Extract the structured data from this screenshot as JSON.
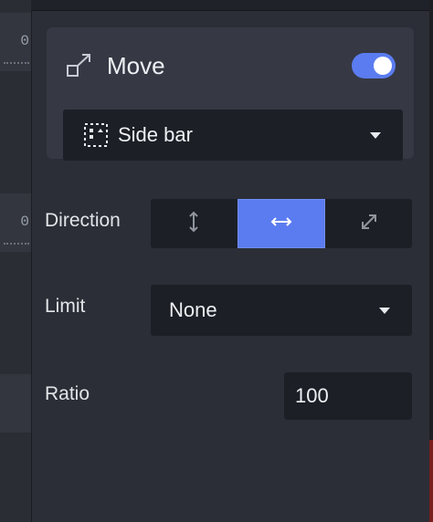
{
  "left_strip": {
    "ruler_digits": [
      "0",
      "0"
    ]
  },
  "card": {
    "title": "Move",
    "icon": "move-icon",
    "toggle_on": true,
    "accent": "#5b7cf0",
    "target_select": {
      "value": "Side bar",
      "icon": "sidebar-icon"
    }
  },
  "direction": {
    "label": "Direction",
    "options": [
      {
        "icon": "vertical-arrow-icon",
        "active": false
      },
      {
        "icon": "horizontal-arrow-icon",
        "active": true
      },
      {
        "icon": "diagonal-arrow-icon",
        "active": false
      }
    ]
  },
  "limit": {
    "label": "Limit",
    "value": "None"
  },
  "ratio": {
    "label": "Ratio",
    "value": "100"
  }
}
